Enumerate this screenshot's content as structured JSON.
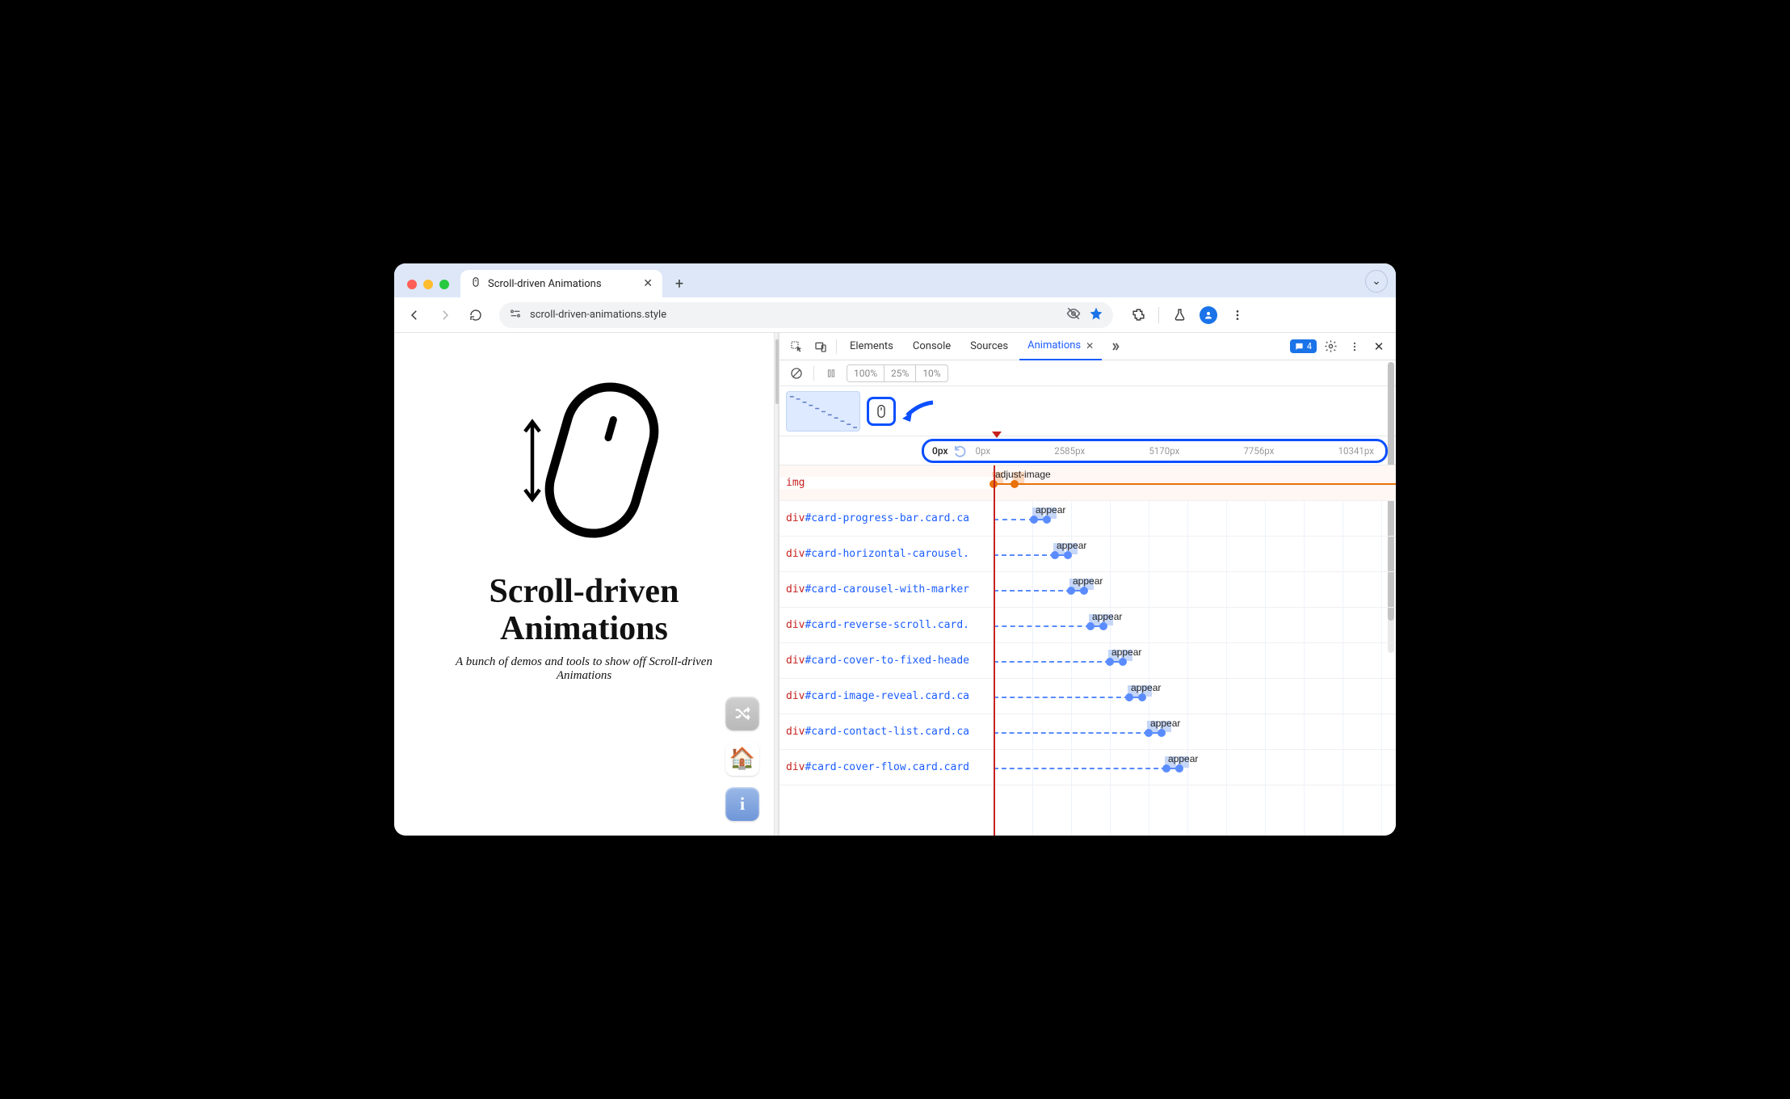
{
  "browser": {
    "tab_title": "Scroll-driven Animations",
    "url": "scroll-driven-animations.style"
  },
  "page": {
    "title_line1": "Scroll-driven",
    "title_line2": "Animations",
    "subtitle": "A bunch of demos and tools to show off Scroll-driven Animations"
  },
  "devtools": {
    "tabs": [
      "Elements",
      "Console",
      "Sources",
      "Animations"
    ],
    "active_tab": "Animations",
    "issue_count": "4",
    "speed_options": [
      "100%",
      "25%",
      "10%"
    ],
    "ruler": {
      "current": "0px",
      "ticks": [
        "0px",
        "2585px",
        "5170px",
        "7756px",
        "10341px"
      ]
    },
    "rows": [
      {
        "tag": "img",
        "idcls": "",
        "anim": "adjust-image",
        "offset": 0,
        "len": 26,
        "end_dashed": true,
        "color": "orange"
      },
      {
        "tag": "div",
        "idcls": "#card-progress-bar.card.ca",
        "anim": "appear",
        "offset": 50,
        "kf_gap": 16
      },
      {
        "tag": "div",
        "idcls": "#card-horizontal-carousel.",
        "anim": "appear",
        "offset": 76,
        "kf_gap": 16
      },
      {
        "tag": "div",
        "idcls": "#card-carousel-with-marker",
        "anim": "appear",
        "offset": 96,
        "kf_gap": 16
      },
      {
        "tag": "div",
        "idcls": "#card-reverse-scroll.card.",
        "anim": "appear",
        "offset": 120,
        "kf_gap": 16
      },
      {
        "tag": "div",
        "idcls": "#card-cover-to-fixed-heade",
        "anim": "appear",
        "offset": 144,
        "kf_gap": 16
      },
      {
        "tag": "div",
        "idcls": "#card-image-reveal.card.ca",
        "anim": "appear",
        "offset": 168,
        "kf_gap": 16
      },
      {
        "tag": "div",
        "idcls": "#card-contact-list.card.ca",
        "anim": "appear",
        "offset": 192,
        "kf_gap": 16
      },
      {
        "tag": "div",
        "idcls": "#card-cover-flow.card.card",
        "anim": "appear",
        "offset": 214,
        "kf_gap": 16
      }
    ]
  }
}
